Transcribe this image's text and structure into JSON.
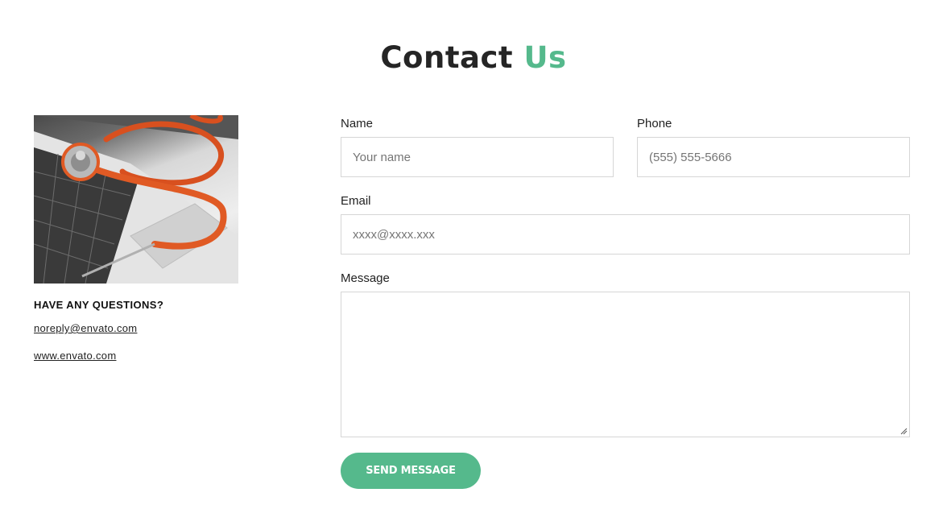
{
  "header": {
    "title_main": "Contact",
    "title_accent": "Us",
    "accent_color": "#55b98c"
  },
  "sidebar": {
    "image_icon": "stethoscope-laptop-photo",
    "questions_heading": "HAVE ANY QUESTIONS?",
    "email_link": "noreply@envato.com",
    "website_link": "www.envato.com"
  },
  "form": {
    "name": {
      "label": "Name",
      "placeholder": "Your name"
    },
    "phone": {
      "label": "Phone",
      "placeholder": "(555) 555-5666"
    },
    "email": {
      "label": "Email",
      "placeholder": "xxxx@xxxx.xxx"
    },
    "message": {
      "label": "Message",
      "placeholder": ""
    },
    "submit_label": "SEND MESSAGE",
    "button_color": "#55b98c"
  }
}
